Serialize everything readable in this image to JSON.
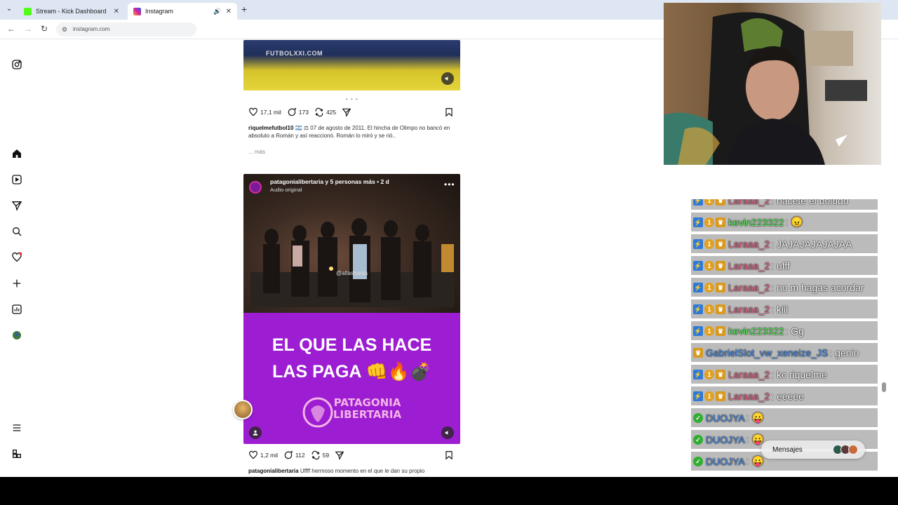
{
  "browser": {
    "tabs": [
      {
        "title": "Stream - Kick Dashboard",
        "fav_color": "#53fc18"
      },
      {
        "title": "Instagram",
        "fav_color": "#d6249f"
      }
    ],
    "address": "instagram.com"
  },
  "post1": {
    "logo": "FUTBOLXXI.COM",
    "likes": "17,1 mil",
    "comments": "173",
    "reposts": "425",
    "username": "riquelmefutbol10",
    "caption": "🇦🇷 ⚖ 07 de agosto de 2011. El hincha de Olimpo no bancó en absoluto a Román y así reaccionó. Román lo miró y se rió..",
    "more": "... más"
  },
  "post2": {
    "header": "patagonialibertaria y 5 personas más • 2 d",
    "audio": "Audio original",
    "watermark": "@altashanta",
    "promo_line1": "EL QUE LAS HACE",
    "promo_line2": "LAS PAGA 👊🔥💣",
    "brand_line1": "PATAGONIA",
    "brand_line2": "LIBERTARIA",
    "likes": "1,2 mil",
    "comments": "112",
    "reposts": "59",
    "username": "patagonialibertaria",
    "caption": "Uffff hermoso momento en el que le dan su propio"
  },
  "chat": {
    "messages": [
      {
        "user": "Laraaa_2",
        "color": "#e86a8a",
        "badges": [
          "bot",
          "coin",
          "crown"
        ],
        "text": ": hacete el boludo"
      },
      {
        "user": "kevin223322",
        "color": "#5cf25c",
        "badges": [
          "bot",
          "coin",
          "crown"
        ],
        "text": ": 😠"
      },
      {
        "user": "Laraaa_2",
        "color": "#e86a8a",
        "badges": [
          "bot",
          "coin",
          "crown"
        ],
        "text": ": JAJAJAJAJAJAA"
      },
      {
        "user": "Laraaa_2",
        "color": "#e86a8a",
        "badges": [
          "bot",
          "coin",
          "crown"
        ],
        "text": ": ufff"
      },
      {
        "user": "Laraaa_2",
        "color": "#e86a8a",
        "badges": [
          "bot",
          "coin",
          "crown"
        ],
        "text": ": no m hagas acordar"
      },
      {
        "user": "Laraaa_2",
        "color": "#e86a8a",
        "badges": [
          "bot",
          "coin",
          "crown"
        ],
        "text": ": kiii"
      },
      {
        "user": "kevin223322",
        "color": "#5cf25c",
        "badges": [
          "bot",
          "coin",
          "crown"
        ],
        "text": ": Gg"
      },
      {
        "user": "GabrielSlot_vw_xeneize_JS",
        "color": "#4a8ee8",
        "badges": [
          "crown"
        ],
        "text": ": genio"
      },
      {
        "user": "Laraaa_2",
        "color": "#e86a8a",
        "badges": [
          "bot",
          "coin",
          "crown"
        ],
        "text": ": kc riquelme"
      },
      {
        "user": "Laraaa_2",
        "color": "#e86a8a",
        "badges": [
          "bot",
          "coin",
          "crown"
        ],
        "text": ": eeeee"
      },
      {
        "user": "DUOJYA",
        "color": "#4a8ee8",
        "badges": [
          "check"
        ],
        "text": ": 😛"
      },
      {
        "user": "DUOJYA",
        "color": "#4a8ee8",
        "badges": [
          "check"
        ],
        "text": ": 😛"
      },
      {
        "user": "DUOJYA",
        "color": "#4a8ee8",
        "badges": [
          "check"
        ],
        "text": ": 😛"
      }
    ]
  },
  "messages_popup": {
    "label": "Mensajes"
  }
}
